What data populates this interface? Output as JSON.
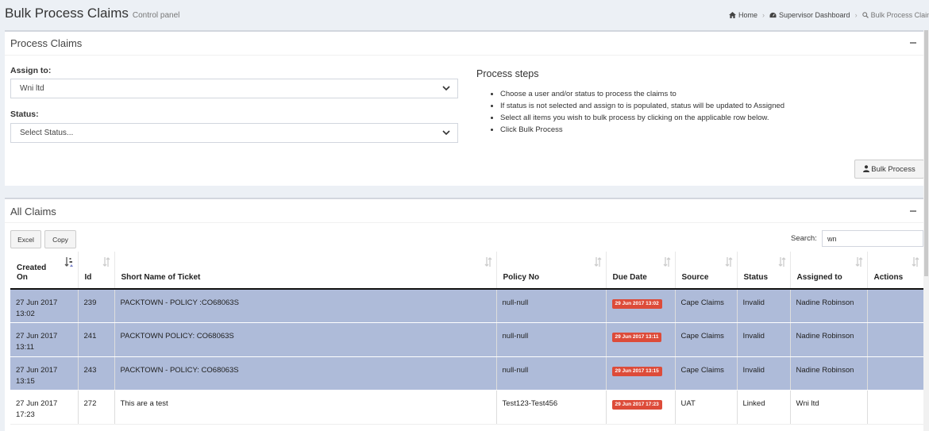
{
  "header": {
    "title": "Bulk Process Claims",
    "subtitle": "Control panel",
    "breadcrumb": [
      "Home",
      "Supervisor Dashboard",
      "Bulk Process Claim"
    ]
  },
  "process_box": {
    "title": "Process Claims",
    "assign_label": "Assign to:",
    "assign_value": "Wni ltd",
    "status_label": "Status:",
    "status_value": "Select Status...",
    "steps_title": "Process steps",
    "steps": [
      "Choose a user and/or status to process the claims to",
      "If status is not selected and assign to is populated, status will be updated to Assigned",
      "Select all items you wish to bulk process by clicking on the applicable row below.",
      "Click Bulk Process"
    ],
    "bulk_button": "Bulk Process"
  },
  "claims_box": {
    "title": "All Claims",
    "excel_button": "Excel",
    "copy_button": "Copy",
    "search_label": "Search:",
    "search_value": "wn",
    "columns": [
      "Created On",
      "Id",
      "Short Name of Ticket",
      "Policy No",
      "Due Date",
      "Source",
      "Status",
      "Assigned to",
      "Actions"
    ],
    "rows": [
      {
        "created": "27 Jun 2017 13:02",
        "id": "239",
        "name": "PACKTOWN - POLICY :CO68063S",
        "policy": "null-null",
        "due": "29 Jun 2017 13:02",
        "source": "Cape Claims",
        "status": "Invalid",
        "assigned": "Nadine Robinson",
        "selected": true
      },
      {
        "created": "27 Jun 2017 13:11",
        "id": "241",
        "name": "PACKTOWN POLICY: CO68063S",
        "policy": "null-null",
        "due": "29 Jun 2017 13:11",
        "source": "Cape Claims",
        "status": "Invalid",
        "assigned": "Nadine Robinson",
        "selected": true
      },
      {
        "created": "27 Jun 2017 13:15",
        "id": "243",
        "name": "PACKTOWN - POLICY: CO68063S",
        "policy": "null-null",
        "due": "29 Jun 2017 13:15",
        "source": "Cape Claims",
        "status": "Invalid",
        "assigned": "Nadine Robinson",
        "selected": true
      },
      {
        "created": "27 Jun 2017 17:23",
        "id": "272",
        "name": "This are a test",
        "policy": "Test123-Test456",
        "due": "29 Jun 2017 17:23",
        "source": "UAT",
        "status": "Linked",
        "assigned": "Wni ltd",
        "selected": false
      }
    ]
  },
  "colors": {
    "selected_row": "#aebbd9",
    "badge": "#dd4b39",
    "background": "#ecf0f5"
  }
}
